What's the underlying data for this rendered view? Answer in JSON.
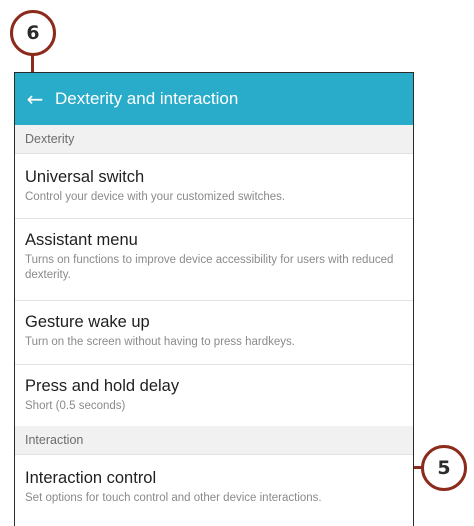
{
  "callouts": {
    "top": "6",
    "right": "5"
  },
  "appbar": {
    "back_icon": "arrow-left-icon",
    "title": "Dexterity and interaction"
  },
  "sections": {
    "dexterity": "Dexterity",
    "interaction": "Interaction"
  },
  "items": [
    {
      "title": "Universal switch",
      "subtitle": "Control your device with your customized switches."
    },
    {
      "title": "Assistant menu",
      "subtitle": "Turns on functions to improve device accessibility for users with reduced dexterity."
    },
    {
      "title": "Gesture wake up",
      "subtitle": "Turn on the screen without having to press hardkeys."
    },
    {
      "title": "Press and hold delay",
      "subtitle": "Short (0.5 seconds)"
    },
    {
      "title": "Interaction control",
      "subtitle": "Set options for touch control and other device interactions."
    }
  ],
  "colors": {
    "appbar": "#29acc9",
    "callout": "#8c2a1c"
  }
}
